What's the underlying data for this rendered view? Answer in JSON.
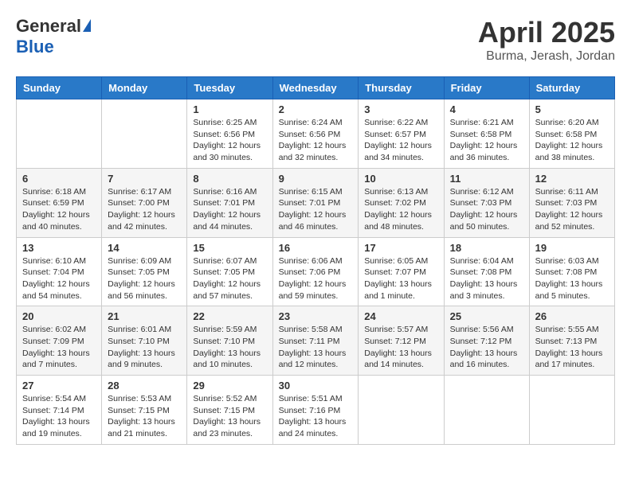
{
  "logo": {
    "general": "General",
    "blue": "Blue"
  },
  "title": "April 2025",
  "location": "Burma, Jerash, Jordan",
  "days_header": [
    "Sunday",
    "Monday",
    "Tuesday",
    "Wednesday",
    "Thursday",
    "Friday",
    "Saturday"
  ],
  "weeks": [
    [
      {
        "day": "",
        "sunrise": "",
        "sunset": "",
        "daylight": ""
      },
      {
        "day": "",
        "sunrise": "",
        "sunset": "",
        "daylight": ""
      },
      {
        "day": "1",
        "sunrise": "Sunrise: 6:25 AM",
        "sunset": "Sunset: 6:56 PM",
        "daylight": "Daylight: 12 hours and 30 minutes."
      },
      {
        "day": "2",
        "sunrise": "Sunrise: 6:24 AM",
        "sunset": "Sunset: 6:56 PM",
        "daylight": "Daylight: 12 hours and 32 minutes."
      },
      {
        "day": "3",
        "sunrise": "Sunrise: 6:22 AM",
        "sunset": "Sunset: 6:57 PM",
        "daylight": "Daylight: 12 hours and 34 minutes."
      },
      {
        "day": "4",
        "sunrise": "Sunrise: 6:21 AM",
        "sunset": "Sunset: 6:58 PM",
        "daylight": "Daylight: 12 hours and 36 minutes."
      },
      {
        "day": "5",
        "sunrise": "Sunrise: 6:20 AM",
        "sunset": "Sunset: 6:58 PM",
        "daylight": "Daylight: 12 hours and 38 minutes."
      }
    ],
    [
      {
        "day": "6",
        "sunrise": "Sunrise: 6:18 AM",
        "sunset": "Sunset: 6:59 PM",
        "daylight": "Daylight: 12 hours and 40 minutes."
      },
      {
        "day": "7",
        "sunrise": "Sunrise: 6:17 AM",
        "sunset": "Sunset: 7:00 PM",
        "daylight": "Daylight: 12 hours and 42 minutes."
      },
      {
        "day": "8",
        "sunrise": "Sunrise: 6:16 AM",
        "sunset": "Sunset: 7:01 PM",
        "daylight": "Daylight: 12 hours and 44 minutes."
      },
      {
        "day": "9",
        "sunrise": "Sunrise: 6:15 AM",
        "sunset": "Sunset: 7:01 PM",
        "daylight": "Daylight: 12 hours and 46 minutes."
      },
      {
        "day": "10",
        "sunrise": "Sunrise: 6:13 AM",
        "sunset": "Sunset: 7:02 PM",
        "daylight": "Daylight: 12 hours and 48 minutes."
      },
      {
        "day": "11",
        "sunrise": "Sunrise: 6:12 AM",
        "sunset": "Sunset: 7:03 PM",
        "daylight": "Daylight: 12 hours and 50 minutes."
      },
      {
        "day": "12",
        "sunrise": "Sunrise: 6:11 AM",
        "sunset": "Sunset: 7:03 PM",
        "daylight": "Daylight: 12 hours and 52 minutes."
      }
    ],
    [
      {
        "day": "13",
        "sunrise": "Sunrise: 6:10 AM",
        "sunset": "Sunset: 7:04 PM",
        "daylight": "Daylight: 12 hours and 54 minutes."
      },
      {
        "day": "14",
        "sunrise": "Sunrise: 6:09 AM",
        "sunset": "Sunset: 7:05 PM",
        "daylight": "Daylight: 12 hours and 56 minutes."
      },
      {
        "day": "15",
        "sunrise": "Sunrise: 6:07 AM",
        "sunset": "Sunset: 7:05 PM",
        "daylight": "Daylight: 12 hours and 57 minutes."
      },
      {
        "day": "16",
        "sunrise": "Sunrise: 6:06 AM",
        "sunset": "Sunset: 7:06 PM",
        "daylight": "Daylight: 12 hours and 59 minutes."
      },
      {
        "day": "17",
        "sunrise": "Sunrise: 6:05 AM",
        "sunset": "Sunset: 7:07 PM",
        "daylight": "Daylight: 13 hours and 1 minute."
      },
      {
        "day": "18",
        "sunrise": "Sunrise: 6:04 AM",
        "sunset": "Sunset: 7:08 PM",
        "daylight": "Daylight: 13 hours and 3 minutes."
      },
      {
        "day": "19",
        "sunrise": "Sunrise: 6:03 AM",
        "sunset": "Sunset: 7:08 PM",
        "daylight": "Daylight: 13 hours and 5 minutes."
      }
    ],
    [
      {
        "day": "20",
        "sunrise": "Sunrise: 6:02 AM",
        "sunset": "Sunset: 7:09 PM",
        "daylight": "Daylight: 13 hours and 7 minutes."
      },
      {
        "day": "21",
        "sunrise": "Sunrise: 6:01 AM",
        "sunset": "Sunset: 7:10 PM",
        "daylight": "Daylight: 13 hours and 9 minutes."
      },
      {
        "day": "22",
        "sunrise": "Sunrise: 5:59 AM",
        "sunset": "Sunset: 7:10 PM",
        "daylight": "Daylight: 13 hours and 10 minutes."
      },
      {
        "day": "23",
        "sunrise": "Sunrise: 5:58 AM",
        "sunset": "Sunset: 7:11 PM",
        "daylight": "Daylight: 13 hours and 12 minutes."
      },
      {
        "day": "24",
        "sunrise": "Sunrise: 5:57 AM",
        "sunset": "Sunset: 7:12 PM",
        "daylight": "Daylight: 13 hours and 14 minutes."
      },
      {
        "day": "25",
        "sunrise": "Sunrise: 5:56 AM",
        "sunset": "Sunset: 7:12 PM",
        "daylight": "Daylight: 13 hours and 16 minutes."
      },
      {
        "day": "26",
        "sunrise": "Sunrise: 5:55 AM",
        "sunset": "Sunset: 7:13 PM",
        "daylight": "Daylight: 13 hours and 17 minutes."
      }
    ],
    [
      {
        "day": "27",
        "sunrise": "Sunrise: 5:54 AM",
        "sunset": "Sunset: 7:14 PM",
        "daylight": "Daylight: 13 hours and 19 minutes."
      },
      {
        "day": "28",
        "sunrise": "Sunrise: 5:53 AM",
        "sunset": "Sunset: 7:15 PM",
        "daylight": "Daylight: 13 hours and 21 minutes."
      },
      {
        "day": "29",
        "sunrise": "Sunrise: 5:52 AM",
        "sunset": "Sunset: 7:15 PM",
        "daylight": "Daylight: 13 hours and 23 minutes."
      },
      {
        "day": "30",
        "sunrise": "Sunrise: 5:51 AM",
        "sunset": "Sunset: 7:16 PM",
        "daylight": "Daylight: 13 hours and 24 minutes."
      },
      {
        "day": "",
        "sunrise": "",
        "sunset": "",
        "daylight": ""
      },
      {
        "day": "",
        "sunrise": "",
        "sunset": "",
        "daylight": ""
      },
      {
        "day": "",
        "sunrise": "",
        "sunset": "",
        "daylight": ""
      }
    ]
  ]
}
